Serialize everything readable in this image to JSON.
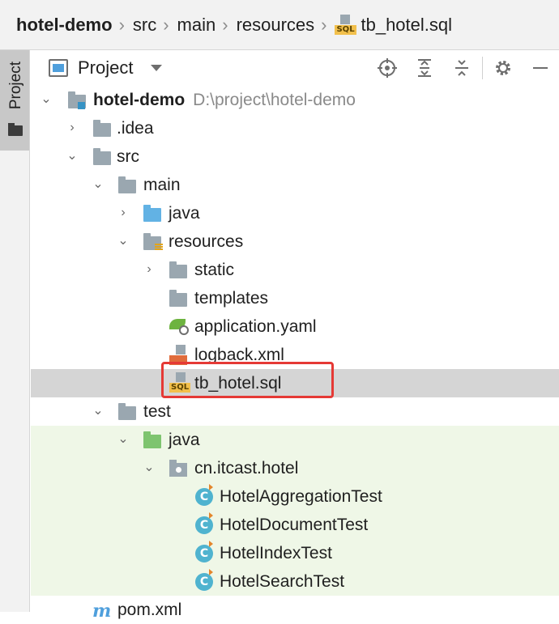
{
  "breadcrumb": {
    "items": [
      "hotel-demo",
      "src",
      "main",
      "resources",
      "tb_hotel.sql"
    ]
  },
  "side_tab": {
    "label": "Project"
  },
  "toolbar": {
    "view_label": "Project",
    "icons": [
      "locate-icon",
      "expand-all-icon",
      "collapse-all-icon",
      "gear-icon",
      "hide-icon"
    ]
  },
  "tree": {
    "root": {
      "name": "hotel-demo",
      "path": "D:\\project\\hotel-demo"
    },
    "idea": ".idea",
    "src": "src",
    "main": "main",
    "main_java": "java",
    "resources": "resources",
    "static": "static",
    "templates": "templates",
    "app_yaml": "application.yaml",
    "logback": "logback.xml",
    "tb_hotel": "tb_hotel.sql",
    "test": "test",
    "test_java": "java",
    "package": "cn.itcast.hotel",
    "classes": [
      "HotelAggregationTest",
      "HotelDocumentTest",
      "HotelIndexTest",
      "HotelSearchTest"
    ],
    "pom": "pom.xml"
  },
  "colors": {
    "highlight_border": "#e53935",
    "selected_row": "#d5d5d5",
    "test_rows": "#eff7e7",
    "folder_blue": "#62b2e4",
    "folder_green": "#7ec46f"
  }
}
